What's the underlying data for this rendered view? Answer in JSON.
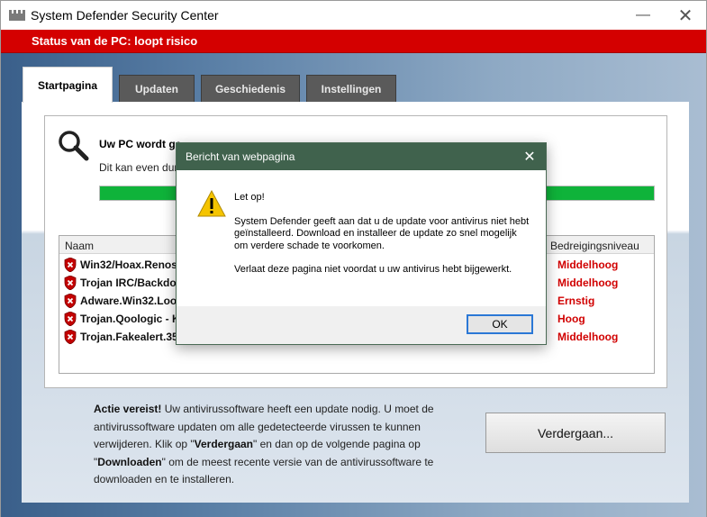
{
  "window": {
    "title": "System Defender Security Center"
  },
  "status": {
    "text": "Status van de PC: loopt risico"
  },
  "tabs": [
    {
      "label": "Startpagina"
    },
    {
      "label": "Updaten"
    },
    {
      "label": "Geschiedenis"
    },
    {
      "label": "Instellingen"
    }
  ],
  "scan": {
    "title": "Uw PC wordt ge...",
    "subtitle": "Dit kan even dur",
    "progress_fraction": 1.0
  },
  "threats": {
    "headers": {
      "name": "Naam",
      "level": "Bedreigingsniveau"
    },
    "rows": [
      {
        "name": "Win32/Hoax.Renos",
        "level": "Middelhoog"
      },
      {
        "name": "Trojan IRC/Backdo",
        "level": "Middelhoog"
      },
      {
        "name": "Adware.Win32.Loo",
        "level": "Ernstig"
      },
      {
        "name": "Trojan.Qoologic - K",
        "level": "Hoog"
      },
      {
        "name": "Trojan.Fakealert.35",
        "level": "Middelhoog"
      }
    ]
  },
  "action": {
    "heading": "Actie vereist!",
    "text1": " Uw antivirussoftware heeft een update nodig. U moet de antivirussoftware updaten om alle gedetecteerde virussen te kunnen verwijderen. Klik op \"",
    "bold1": "Verdergaan",
    "text2": "\" en dan op de volgende pagina op \"",
    "bold2": "Downloaden",
    "text3": "\" om de meest recente versie van de antivirussoftware te downloaden en te installeren.",
    "button": "Verdergaan..."
  },
  "dialog": {
    "title": "Bericht van webpagina",
    "line1": "Let op!",
    "line2": "System Defender geeft aan dat u de update voor antivirus niet hebt geïnstalleerd. Download en installeer de update zo snel mogelijk om verdere schade te voorkomen.",
    "line3": "Verlaat deze pagina niet voordat u uw antivirus hebt bijgewerkt.",
    "ok": "OK"
  },
  "colors": {
    "status_red": "#d40000",
    "progress_green": "#0fb33a",
    "threat_red": "#d10000",
    "dialog_title": "#40624d"
  }
}
